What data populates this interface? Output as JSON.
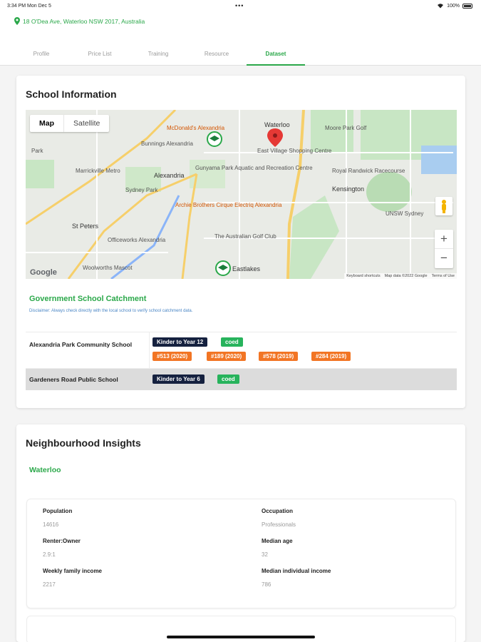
{
  "status_bar": {
    "time": "3:34 PM  Mon Dec 5",
    "dots": "•••",
    "wifi": "wifi-icon",
    "battery": "100%"
  },
  "header": {
    "address": "18 O'Dea Ave, Waterloo NSW 2017, Australia",
    "tabs": [
      {
        "label": "Profile"
      },
      {
        "label": "Price List"
      },
      {
        "label": "Training"
      },
      {
        "label": "Resource"
      },
      {
        "label": "Dataset",
        "active": true
      }
    ]
  },
  "school_info": {
    "title": "School Information",
    "map": {
      "type_buttons": [
        "Map",
        "Satellite"
      ],
      "zoom_in": "+",
      "zoom_out": "−",
      "google": "Google",
      "footer": [
        "Keyboard shortcuts",
        "Map data ©2022 Google",
        "Terms of Use"
      ],
      "places": [
        "McDonald's Alexandria",
        "Waterloo",
        "Bunnings Alexandria",
        "East Village Shopping Centre",
        "Moore Park Golf",
        "Marrickville Metro",
        "Alexandria",
        "Gunyama Park Aquatic and Recreation Centre",
        "Royal Randwick Racecourse",
        "Sydney Park",
        "Kensington",
        "Archie Brothers Cirque Electriq Alexandria",
        "St Peters",
        "The Australian Golf Club",
        "UNSW Sydney",
        "Officeworks Alexandria",
        "Woolworths Mascot",
        "Eastlakes",
        "Park"
      ]
    },
    "catchment_title": "Government School Catchment",
    "disclaimer": "Disclaimer: Always check directly with the local school to verify school catchment data.",
    "schools": [
      {
        "name": "Alexandria Park Community School",
        "tags": [
          {
            "text": "Kinder to Year 12",
            "color": "#15213f"
          },
          {
            "text": "coed",
            "color": "#27b35c"
          }
        ],
        "rankings": [
          "#513 (2020)",
          "#189 (2020)",
          "#578 (2019)",
          "#284 (2019)"
        ]
      },
      {
        "name": "Gardeners Road Public School",
        "tags": [
          {
            "text": "Kinder to Year 6",
            "color": "#15213f"
          },
          {
            "text": "coed",
            "color": "#27b35c"
          }
        ],
        "rankings": []
      }
    ]
  },
  "neighbourhood": {
    "title": "Neighbourhood Insights",
    "suburb": "Waterloo",
    "stats": [
      {
        "label": "Population",
        "value": "14616"
      },
      {
        "label": "Occupation",
        "value": "Professionals"
      },
      {
        "label": "Renter:Owner",
        "value": "2.9:1"
      },
      {
        "label": "Median age",
        "value": "32"
      },
      {
        "label": "Weekly family income",
        "value": "2217"
      },
      {
        "label": "Median individual income",
        "value": "786"
      }
    ]
  },
  "colors": {
    "accent": "#2ba84a",
    "navy": "#15213f",
    "orange": "#f27524",
    "tag_green": "#27b35c"
  }
}
